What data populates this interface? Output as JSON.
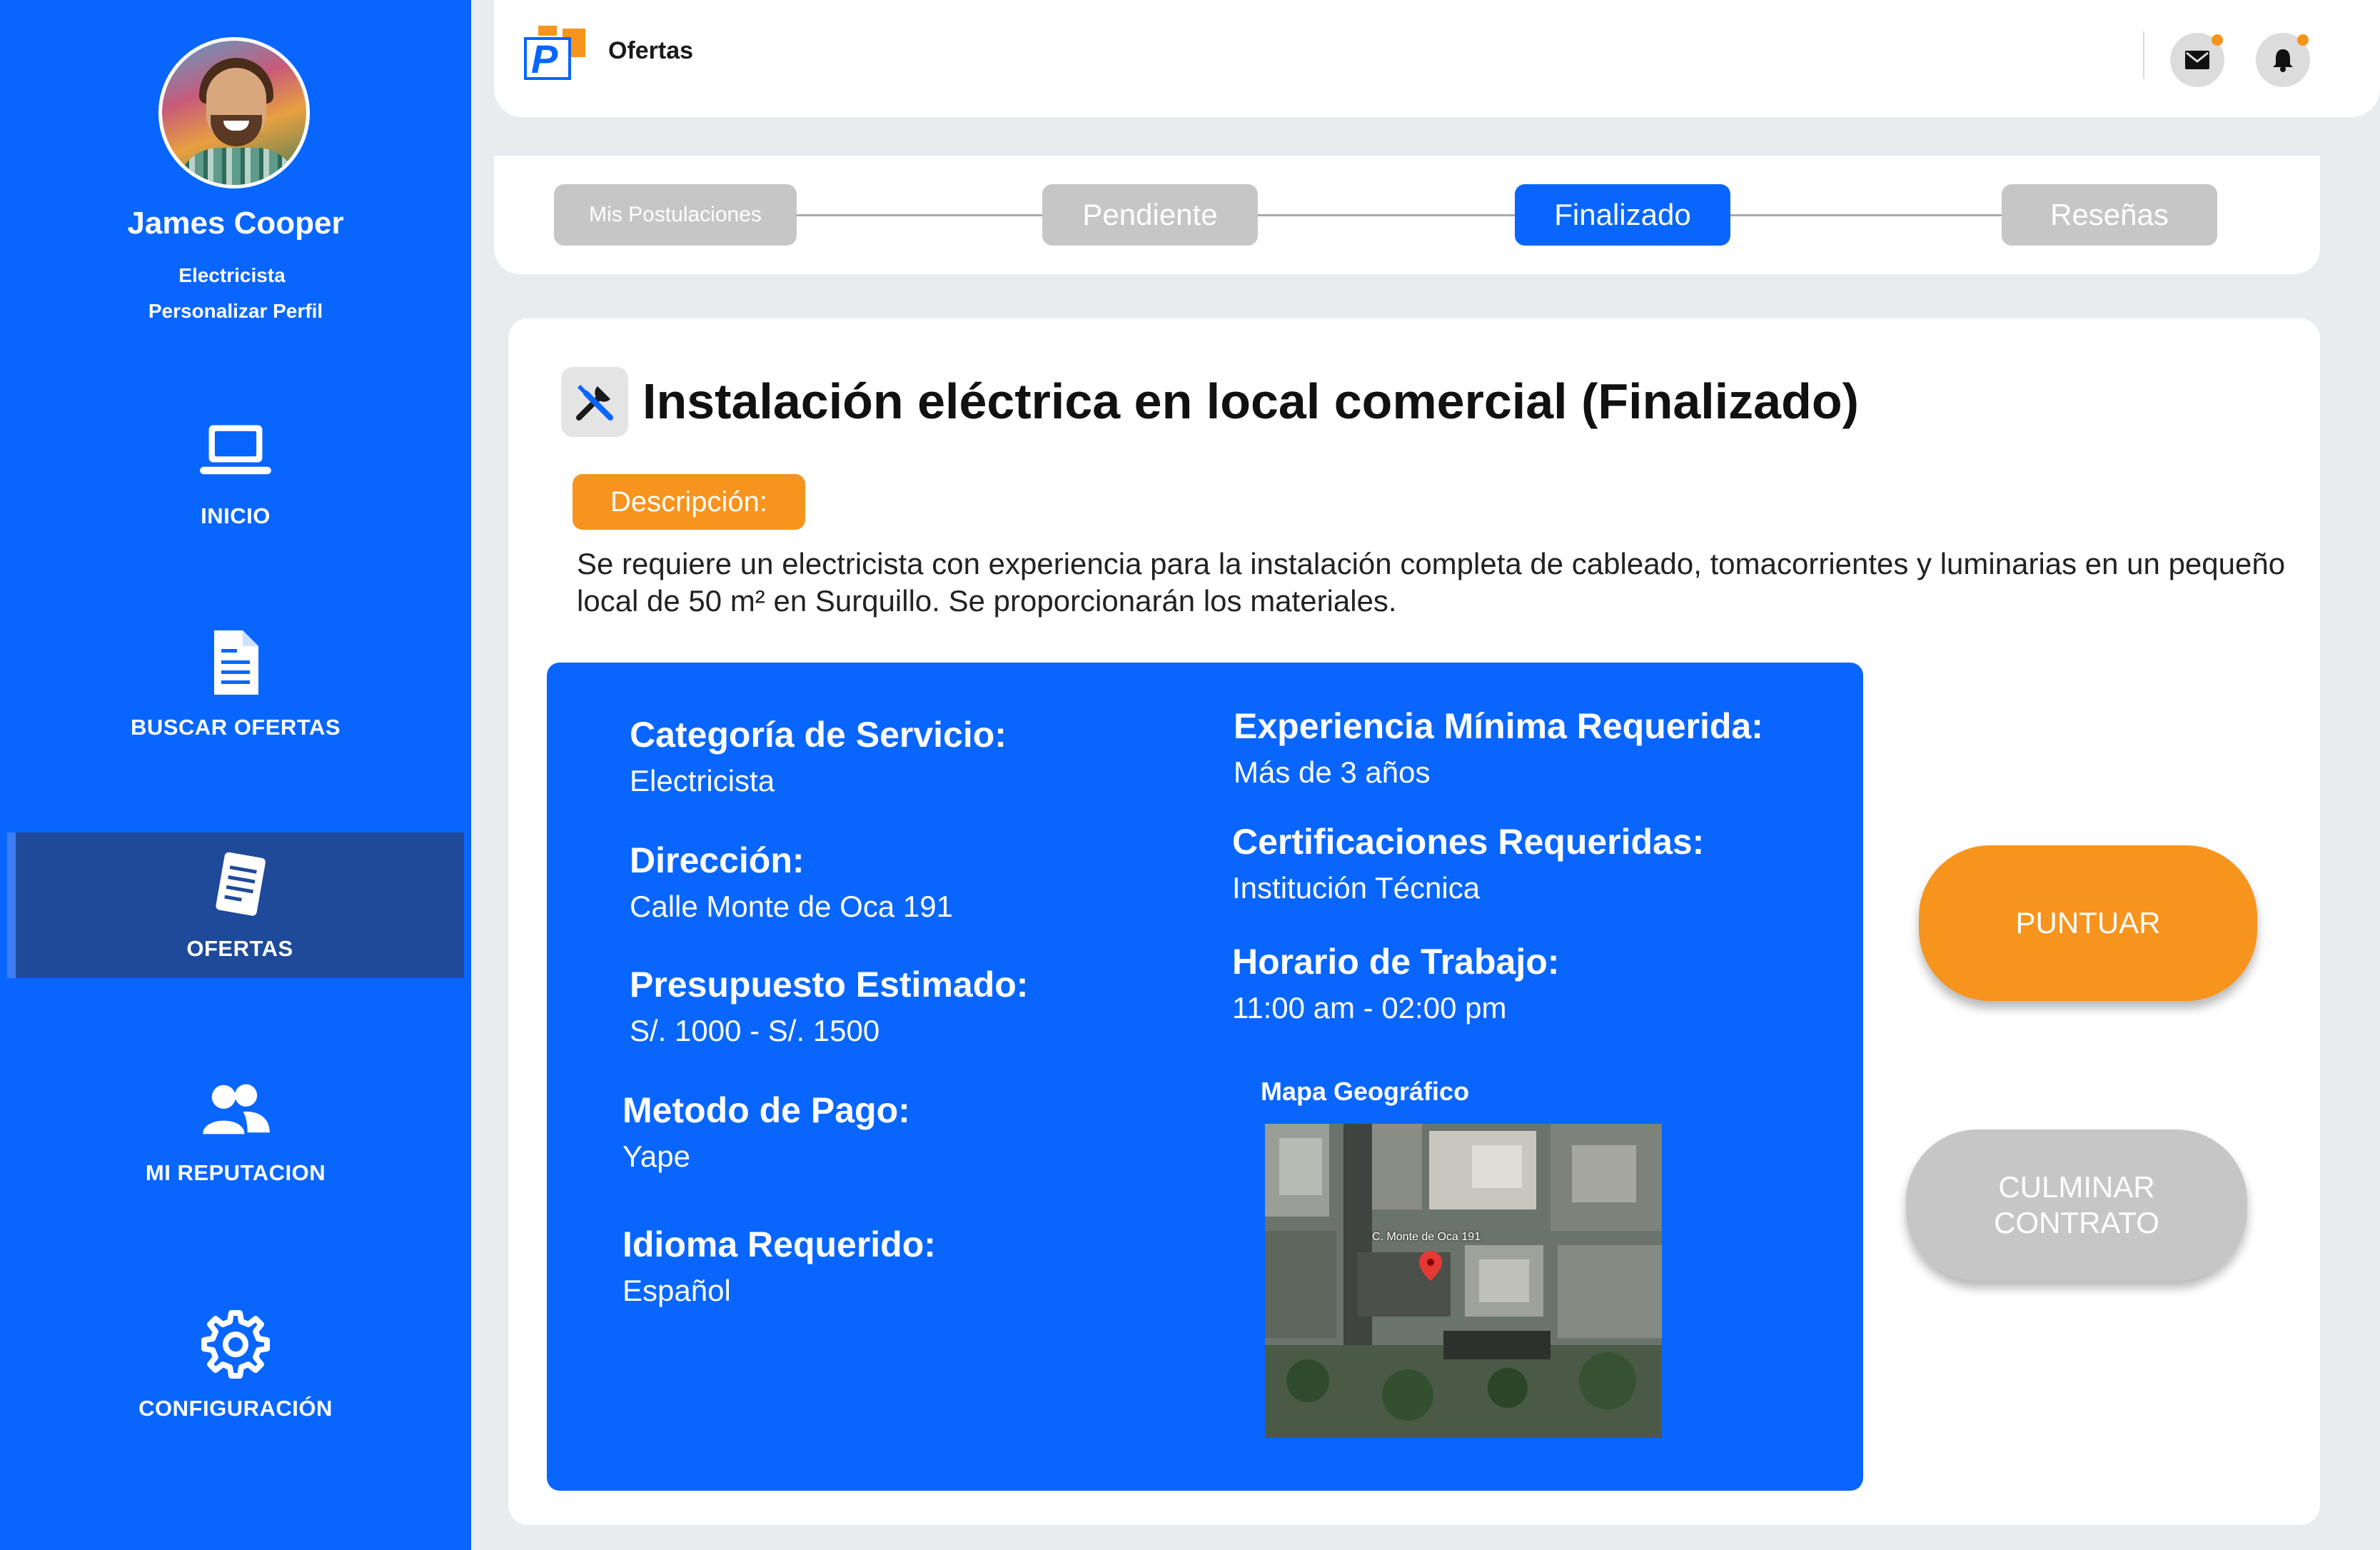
{
  "app": {
    "header_title": "Ofertas",
    "logo_text": "P"
  },
  "user": {
    "name": "James Cooper",
    "role": "Electricista",
    "customize_label": "Personalizar Perfil"
  },
  "sidebar": {
    "items": [
      {
        "label": "INICIO",
        "icon": "laptop-icon",
        "active": false
      },
      {
        "label": "BUSCAR OFERTAS",
        "icon": "document-icon",
        "active": false
      },
      {
        "label": "OFERTAS",
        "icon": "notes-icon",
        "active": true
      },
      {
        "label": "MI REPUTACION",
        "icon": "users-icon",
        "active": false
      },
      {
        "label": "CONFIGURACIÓN",
        "icon": "gear-icon",
        "active": false
      }
    ]
  },
  "stepper": {
    "steps": [
      {
        "label": "Mis Postulaciones",
        "active": false
      },
      {
        "label": "Pendiente",
        "active": false
      },
      {
        "label": "Finalizado",
        "active": true
      },
      {
        "label": "Reseñas",
        "active": false
      }
    ]
  },
  "job": {
    "title": "Instalación eléctrica en local comercial (Finalizado)",
    "description_label": "Descripción:",
    "description": "Se requiere un electricista con experiencia para la instalación completa de cableado, tomacorrientes y luminarias en un pequeño local de 50 m² en Surquillo. Se proporcionarán los materiales.",
    "fields_left": [
      {
        "label": "Categoría de Servicio:",
        "value": "Electricista"
      },
      {
        "label": "Dirección:",
        "value": "Calle Monte de Oca 191"
      },
      {
        "label": "Presupuesto Estimado:",
        "value": "S/. 1000 - S/. 1500"
      },
      {
        "label": "Metodo de Pago:",
        "value": "Yape"
      },
      {
        "label": "Idioma Requerido:",
        "value": "Español"
      }
    ],
    "fields_right": [
      {
        "label": "Experiencia Mínima Requerida:",
        "value": "Más de 3 años"
      },
      {
        "label": "Certificaciones Requeridas:",
        "value": "Institución Técnica"
      },
      {
        "label": "Horario de Trabajo:",
        "value": "11:00 am - 02:00 pm"
      }
    ],
    "map_title": "Mapa Geográfico",
    "map_label": "C. Monte de Oca 191"
  },
  "actions": {
    "rate_label": "PUNTUAR",
    "finish_label": "CULMINAR CONTRATO"
  },
  "colors": {
    "primary": "#0866ff",
    "accent": "#f7941d",
    "inactive": "#c6c6c6",
    "sidebar_active": "#1f4a9a"
  }
}
